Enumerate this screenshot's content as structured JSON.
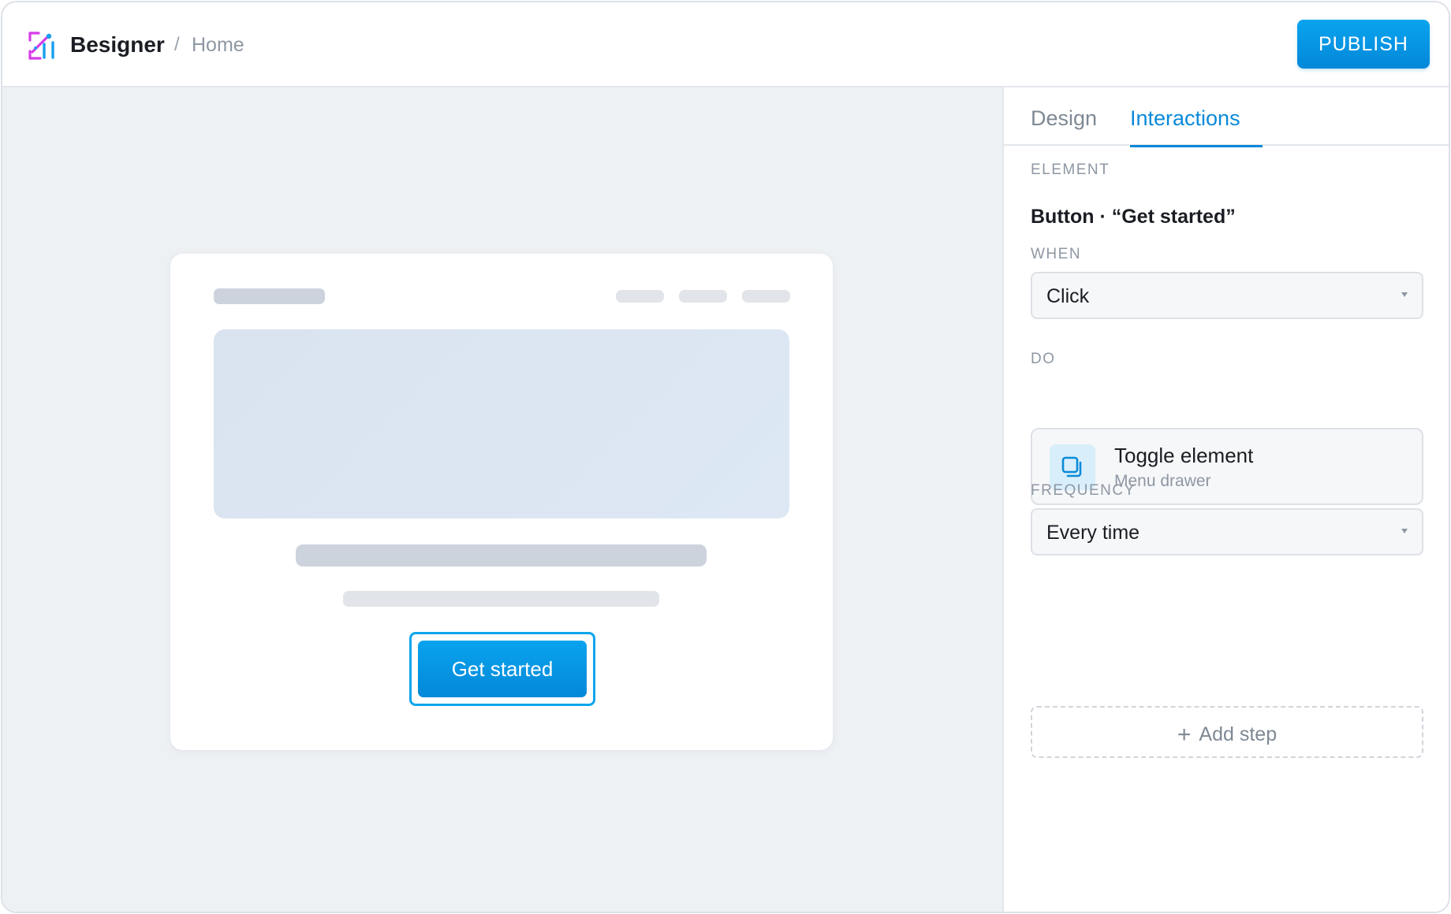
{
  "header": {
    "app_name": "Besigner",
    "breadcrumb_separator": "/",
    "breadcrumb_page": "Home",
    "publish_label": "PUBLISH",
    "logo_icon": "drafting-tools-logo-icon"
  },
  "canvas": {
    "cta_label": "Get started"
  },
  "panel": {
    "tabs": [
      {
        "label": "Design",
        "active": false
      },
      {
        "label": "Interactions",
        "active": true
      }
    ],
    "element": {
      "label": "ELEMENT",
      "value": "Button · “Get started”"
    },
    "when": {
      "label": "WHEN",
      "value": "Click"
    },
    "do": {
      "label": "DO",
      "action_title": "Toggle element",
      "action_subtitle": "Menu drawer",
      "icon": "toggle-copy-icon"
    },
    "frequency": {
      "label": "FREQUENCY",
      "value": "Every time"
    },
    "add_step_label": "Add step"
  },
  "colors": {
    "accent": "#0a8ad8",
    "button_gradient_top": "#0aa3ee",
    "button_gradient_bottom": "#0388d9",
    "canvas_bg": "#eef1f4",
    "logo_magenta": "#d63be8",
    "logo_blue": "#17a0ef"
  }
}
